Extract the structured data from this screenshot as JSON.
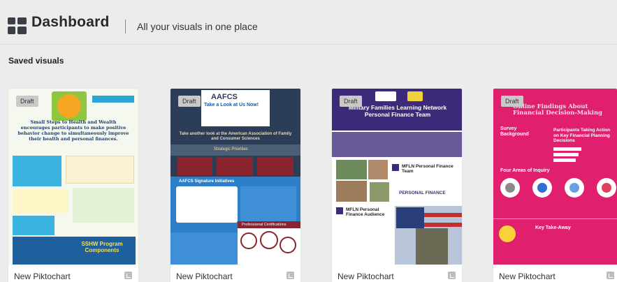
{
  "header": {
    "title": "Dashboard",
    "subtitle": "All your visuals in one place"
  },
  "section": {
    "label": "Saved visuals"
  },
  "cards": [
    {
      "badge": "Draft",
      "caption": "New Piktochart",
      "thumb": {
        "heading": "Small Steps to Health and Wealth encourages participants to make positive behavior change to simultaneously improve their health and personal finances.",
        "footer": "SSHW Program Components"
      }
    },
    {
      "badge": "Draft",
      "caption": "New Piktochart",
      "thumb": {
        "logo": "AAFCS",
        "headline": "Take a Look at Us Now!",
        "subhead": "Take another look at the American Association of Family and Consumer Sciences",
        "priorities": "Strategic Priorities",
        "initiatives": "AAFCS Signature Initiatives",
        "certs": "Professional Certifications"
      }
    },
    {
      "badge": "Draft",
      "caption": "New Piktochart",
      "thumb": {
        "headline": "Military Families Learning Network Personal Finance Team",
        "section1": "MFLN Personal Finance Team",
        "section2": "MFLN Personal Finance Audience",
        "brand": "PERSONAL FINANCE"
      }
    },
    {
      "badge": "Draft",
      "caption": "New Piktochart",
      "thumb": {
        "headline": "Online Findings About Financial Decision-Making",
        "survey": "Survey Background",
        "participants": "Participants Taking Action on Key Financial Planning Decisions",
        "inquiry": "Four Areas of Inquiry",
        "takeaway": "Key Take-Away"
      }
    }
  ],
  "colors": {
    "background": "#ececec",
    "badge": "#c9c9c9",
    "navy": "#2c3e57",
    "purple": "#3d2a78",
    "magenta": "#e0206e"
  }
}
